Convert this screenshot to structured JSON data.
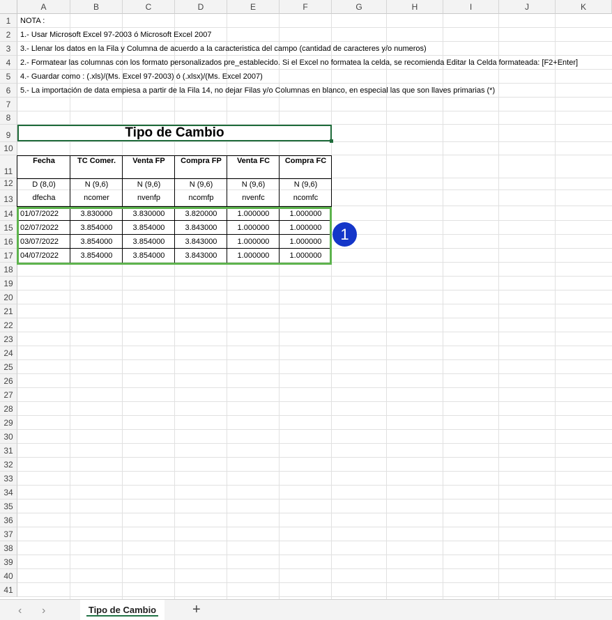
{
  "columns": [
    "A",
    "B",
    "C",
    "D",
    "E",
    "F",
    "G",
    "H",
    "I",
    "J",
    "K"
  ],
  "notes": [
    "NOTA :",
    "1.- Usar Microsoft Excel 97-2003 ó Microsoft Excel 2007",
    "3.- Llenar los datos en la Fila y Columna de acuerdo a la caracteristica del campo (cantidad de caracteres y/o numeros)",
    "2.- Formatear las columnas con los formato personalizados pre_establecido. Si el Excel no formatea la celda, se recomienda Editar la Celda formateada: [F2+Enter]",
    "4.- Guardar como : (.xls)/(Ms. Excel 97-2003)  ó (.xlsx)/(Ms. Excel 2007)",
    "5.- La importación de data empiesa a partir de la Fila 14, no dejar Filas y/o Columnas en blanco, en especial las que son llaves primarias (*)"
  ],
  "table": {
    "title": "Tipo de Cambio",
    "headers": [
      "Fecha",
      "TC Comer.",
      "Venta FP",
      "Compra FP",
      "Venta FC",
      "Compra FC"
    ],
    "formats": [
      "D (8,0)",
      "N (9,6)",
      "N (9,6)",
      "N (9,6)",
      "N (9,6)",
      "N (9,6)"
    ],
    "fields": [
      "dfecha",
      "ncomer",
      "nvenfp",
      "ncomfp",
      "nvenfc",
      "ncomfc"
    ],
    "rows": [
      [
        "01/07/2022",
        "3.830000",
        "3.830000",
        "3.820000",
        "1.000000",
        "1.000000"
      ],
      [
        "02/07/2022",
        "3.854000",
        "3.854000",
        "3.843000",
        "1.000000",
        "1.000000"
      ],
      [
        "03/07/2022",
        "3.854000",
        "3.854000",
        "3.843000",
        "1.000000",
        "1.000000"
      ],
      [
        "04/07/2022",
        "3.854000",
        "3.854000",
        "3.843000",
        "1.000000",
        "1.000000"
      ]
    ]
  },
  "callout": {
    "number": "1",
    "color": "#1436c9",
    "highlight_color": "#5db34d"
  },
  "tabbar": {
    "active_tab": "Tipo de Cambio",
    "add_label": "+",
    "prev": "‹",
    "next": "›"
  }
}
